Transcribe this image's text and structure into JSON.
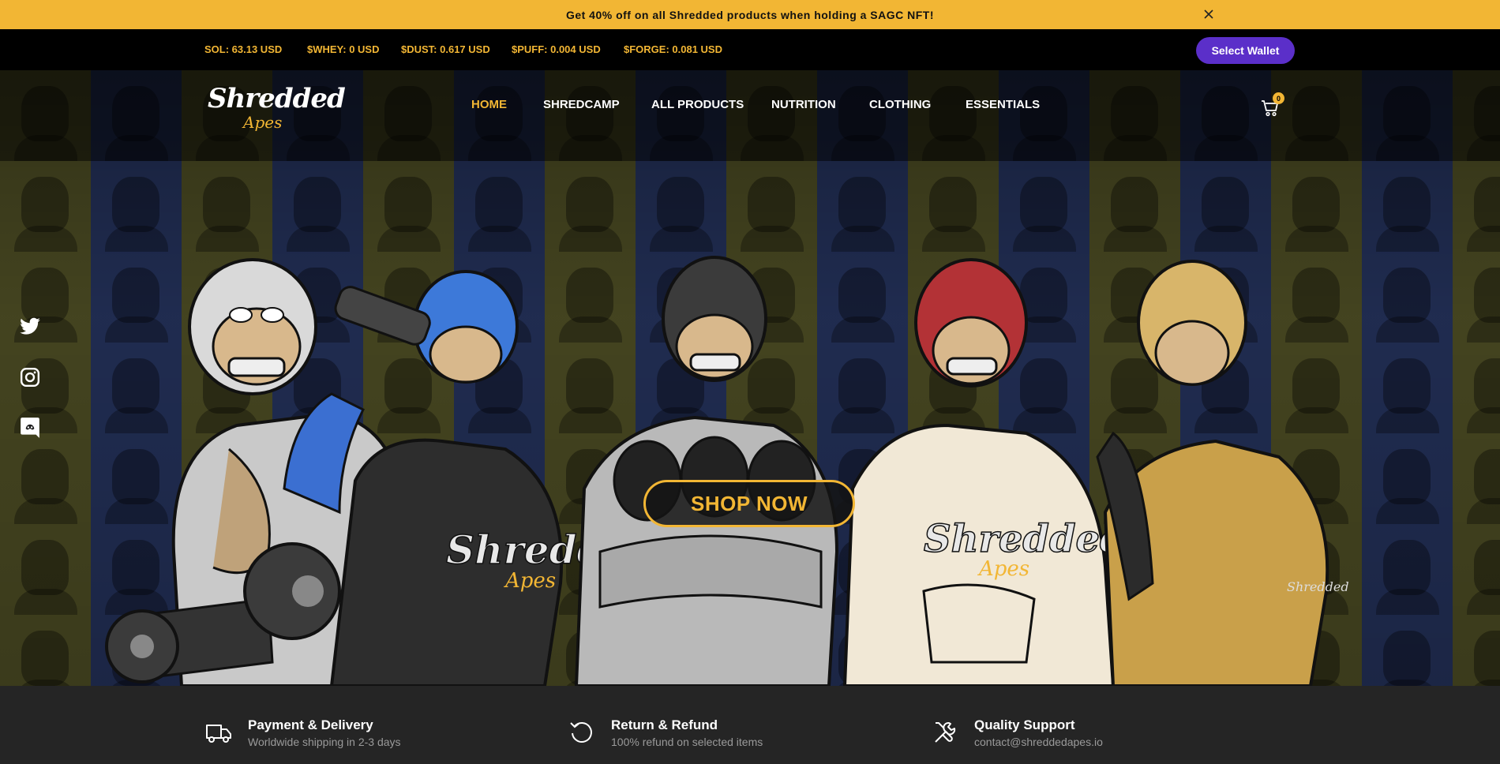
{
  "promo": {
    "text": "Get 40% off on all Shredded products when holding a SAGC NFT!",
    "close_icon": "close-icon"
  },
  "ticker": {
    "sol": "SOL: 63.13 USD",
    "whey": "$WHEY: 0 USD",
    "dust": "$DUST: 0.617 USD",
    "puff": "$PUFF: 0.004 USD",
    "forge": "$FORGE: 0.081 USD"
  },
  "wallet_button": "Select Wallet",
  "logo": {
    "main": "Shredded",
    "sub": "Apes"
  },
  "nav": {
    "home": "HOME",
    "shredcamp": "SHREDCAMP",
    "all_products": "ALL PRODUCTS",
    "nutrition": "NUTRITION",
    "clothing": "CLOTHING",
    "essentials": "ESSENTIALS"
  },
  "cart": {
    "count": "0",
    "icon": "cart-icon"
  },
  "social": {
    "twitter": "twitter-icon",
    "instagram": "instagram-icon",
    "discord": "discord-icon"
  },
  "hero": {
    "shop_now": "SHOP NOW",
    "shirt_brand": "Shredded",
    "shirt_sub": "Apes",
    "towel_brand": "Shredded"
  },
  "features": [
    {
      "title": "Payment & Delivery",
      "subtitle": "Worldwide shipping in 2-3 days",
      "icon": "truck-icon"
    },
    {
      "title": "Return & Refund",
      "subtitle": "100% refund on selected items",
      "icon": "refresh-icon"
    },
    {
      "title": "Quality Support",
      "subtitle": "contact@shreddedapes.io",
      "icon": "tools-icon"
    }
  ],
  "colors": {
    "accent": "#f2b634",
    "wallet": "#5b2fc9",
    "ticker_bg": "#000000",
    "footer_bg": "#252525"
  }
}
